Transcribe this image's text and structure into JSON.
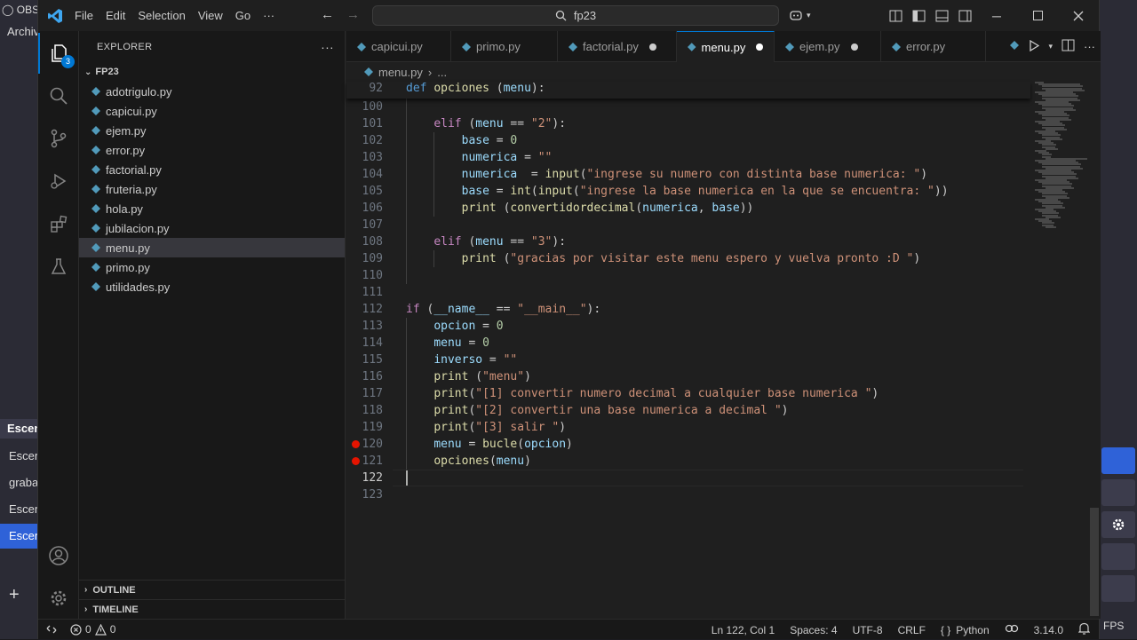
{
  "background_app": {
    "title": "OBS",
    "menu": "Archiv",
    "items": [
      "Escen",
      "Escen",
      "graba",
      "Escen",
      "Escen"
    ],
    "fps_label": "FPS",
    "plus": "+"
  },
  "titlebar": {
    "menu": [
      "File",
      "Edit",
      "Selection",
      "View",
      "Go",
      "···"
    ],
    "search": "fp23"
  },
  "activity_bar": {
    "explorer_badge": "3"
  },
  "sidebar": {
    "title": "EXPLORER",
    "more": "···",
    "folder": "FP23",
    "files": [
      "adotrigulo.py",
      "capicui.py",
      "ejem.py",
      "error.py",
      "factorial.py",
      "fruteria.py",
      "hola.py",
      "jubilacion.py",
      "menu.py",
      "primo.py",
      "utilidades.py"
    ],
    "selected": "menu.py",
    "outline": "OUTLINE",
    "timeline": "TIMELINE"
  },
  "tabs": [
    {
      "label": "capicui.py",
      "modified": false,
      "active": false
    },
    {
      "label": "primo.py",
      "modified": false,
      "active": false
    },
    {
      "label": "factorial.py",
      "modified": true,
      "active": false
    },
    {
      "label": "menu.py",
      "modified": true,
      "active": true
    },
    {
      "label": "ejem.py",
      "modified": true,
      "active": false
    },
    {
      "label": "error.py",
      "modified": false,
      "active": false
    }
  ],
  "breadcrumb": {
    "file": "menu.py",
    "rest": "..."
  },
  "editor": {
    "sticky": {
      "num": "92",
      "code": "def opciones (menu):"
    },
    "lines": [
      {
        "num": "100",
        "code": ""
      },
      {
        "num": "101",
        "code": "    elif (menu == \"2\"):"
      },
      {
        "num": "102",
        "code": "        base = 0"
      },
      {
        "num": "103",
        "code": "        numerica = \"\""
      },
      {
        "num": "104",
        "code": "        numerica  = input(\"ingrese su numero con distinta base numerica: \")"
      },
      {
        "num": "105",
        "code": "        base = int(input(\"ingrese la base numerica en la que se encuentra: \"))"
      },
      {
        "num": "106",
        "code": "        print (convertidordecimal(numerica, base))"
      },
      {
        "num": "107",
        "code": ""
      },
      {
        "num": "108",
        "code": "    elif (menu == \"3\"):"
      },
      {
        "num": "109",
        "code": "        print (\"gracias por visitar este menu espero y vuelva pronto :D \")"
      },
      {
        "num": "110",
        "code": ""
      },
      {
        "num": "111",
        "code": ""
      },
      {
        "num": "112",
        "code": "if (__name__ == \"__main__\"):"
      },
      {
        "num": "113",
        "code": "    opcion = 0"
      },
      {
        "num": "114",
        "code": "    menu = 0"
      },
      {
        "num": "115",
        "code": "    inverso = \"\""
      },
      {
        "num": "116",
        "code": "    print (\"menu\")"
      },
      {
        "num": "117",
        "code": "    print(\"[1] convertir numero decimal a cualquier base numerica \")"
      },
      {
        "num": "118",
        "code": "    print(\"[2] convertir una base numerica a decimal \")"
      },
      {
        "num": "119",
        "code": "    print(\"[3] salir \")"
      },
      {
        "num": "120",
        "code": "    menu = bucle(opcion)",
        "breakpoint": true
      },
      {
        "num": "121",
        "code": "    opciones(menu)",
        "breakpoint": true
      },
      {
        "num": "122",
        "code": "",
        "current": true
      },
      {
        "num": "123",
        "code": ""
      }
    ]
  },
  "statusbar": {
    "errors": "0",
    "warnings": "0",
    "position": "Ln 122, Col 1",
    "spaces": "Spaces: 4",
    "encoding": "UTF-8",
    "eol": "CRLF",
    "language_braces": "{ }",
    "language": "Python",
    "version": "3.14.0"
  },
  "colors": {
    "accent": "#0078d4",
    "breakpoint": "#e51400",
    "keyword": "#569cd6",
    "control": "#c586c0",
    "function": "#dcdcaa",
    "string": "#ce9178",
    "number": "#b5cea8",
    "variable": "#9cdcfe"
  }
}
